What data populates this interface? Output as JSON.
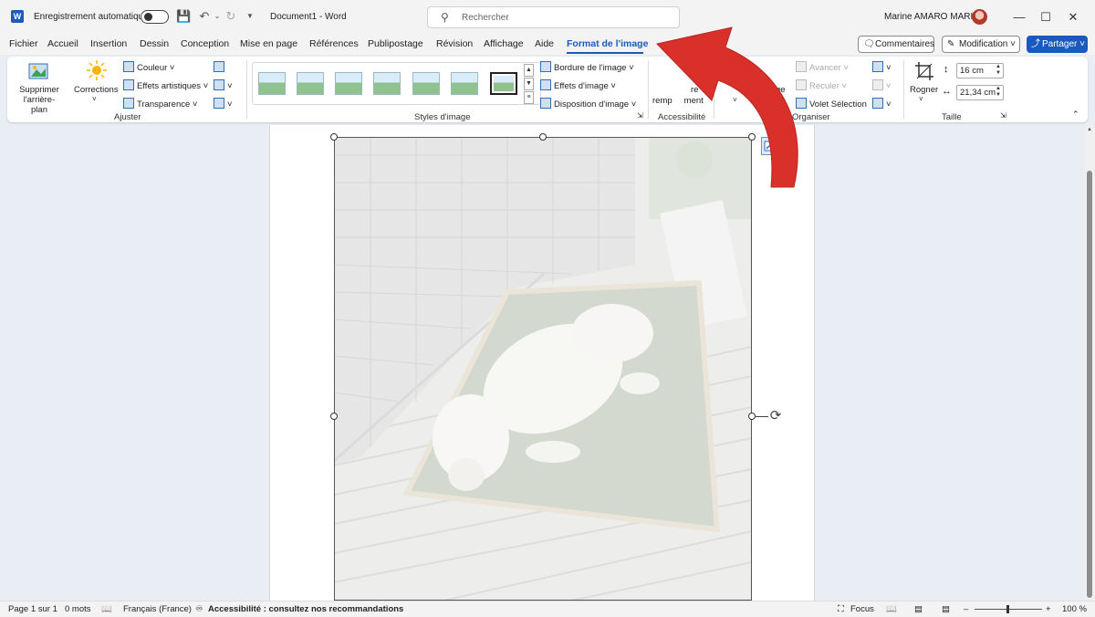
{
  "titlebar": {
    "app_logo": "W",
    "autosave_label": "Enregistrement automatique",
    "doc_title": "Document1  -  Word",
    "search_placeholder": "Rechercher",
    "user_name": "Marine AMARO MARIA"
  },
  "menu": {
    "tabs": [
      "Fichier",
      "Accueil",
      "Insertion",
      "Dessin",
      "Conception",
      "Mise en page",
      "Références",
      "Publipostage",
      "Révision",
      "Affichage",
      "Aide",
      "Format de l'image"
    ],
    "active_tab": "Format de l'image",
    "comments_label": "Commentaires",
    "mode_label": "Modification",
    "share_label": "Partager"
  },
  "ribbon": {
    "ajuster": {
      "label": "Ajuster",
      "remove_bg": "Supprimer l'arrière-plan",
      "corrections": "Corrections",
      "couleur": "Couleur",
      "effets_artistiques": "Effets artistiques",
      "transparence": "Transparence"
    },
    "styles": {
      "label": "Styles d'image",
      "bordure": "Bordure de l'image",
      "effets": "Effets d'image",
      "disposition": "Disposition d'image"
    },
    "accessibilite": {
      "label": "Accessibilité",
      "alt_text_line1": "re",
      "alt_text_line2": "remp",
      "alt_text_line3": "ment"
    },
    "organiser": {
      "label": "Organiser",
      "avancer": "Avancer",
      "reculer": "Reculer",
      "volet": "Volet Sélection",
      "partial": "ge"
    },
    "taille": {
      "label": "Taille",
      "rogner": "Rogner",
      "height": "16 cm",
      "width": "21,34 cm"
    }
  },
  "statusbar": {
    "page": "Page 1 sur 1",
    "words": "0 mots",
    "language": "Français (France)",
    "accessibility": "Accessibilité : consultez nos recommandations",
    "focus": "Focus",
    "zoom": "100 %"
  },
  "colors": {
    "accent": "#185abd",
    "arrow": "#d9302a"
  }
}
